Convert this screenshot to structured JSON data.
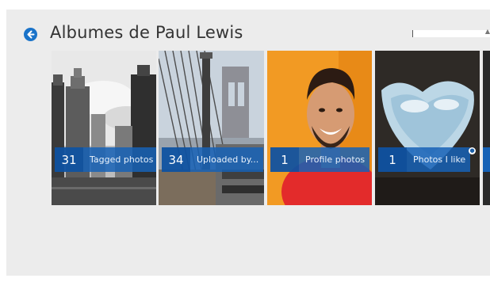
{
  "header": {
    "title": "Albumes de Paul Lewis",
    "back_icon": "back-arrow-icon",
    "search": {
      "value": "",
      "placeholder": ""
    }
  },
  "albums": [
    {
      "count": "31",
      "label": "Tagged photos",
      "icon": "photo-city-buildings"
    },
    {
      "count": "34",
      "label": "Uploaded by...",
      "icon": "photo-brooklyn-bridge"
    },
    {
      "count": "1",
      "label": "Profile photos",
      "icon": "photo-portrait"
    },
    {
      "count": "1",
      "label": "Photos I like",
      "icon": "photo-heart-cloud"
    }
  ],
  "colors": {
    "accent": "#1a73c9",
    "overlay": "#1662b6",
    "background": "#ececec"
  }
}
